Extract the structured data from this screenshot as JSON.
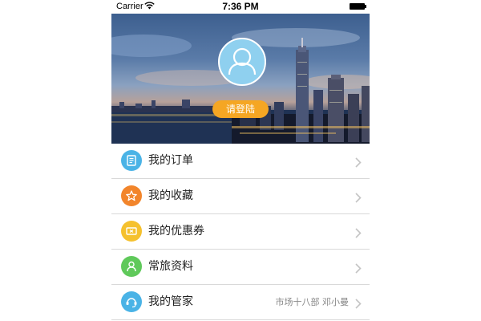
{
  "status_bar": {
    "carrier": "Carrier",
    "time": "7:36 PM"
  },
  "header": {
    "login_label": "请登陆"
  },
  "menu": {
    "items": [
      {
        "label": "我的订单",
        "icon": "order-icon",
        "color": "#4ab3e6",
        "detail": ""
      },
      {
        "label": "我的收藏",
        "icon": "star-icon",
        "color": "#f2852b",
        "detail": ""
      },
      {
        "label": "我的优惠券",
        "icon": "coupon-icon",
        "color": "#f5c12e",
        "detail": ""
      },
      {
        "label": "常旅资料",
        "icon": "traveler-icon",
        "color": "#5fc95a",
        "detail": ""
      },
      {
        "label": "我的管家",
        "icon": "butler-icon",
        "color": "#4ab3e6",
        "detail": "市场十八部 邓小曼"
      }
    ]
  }
}
